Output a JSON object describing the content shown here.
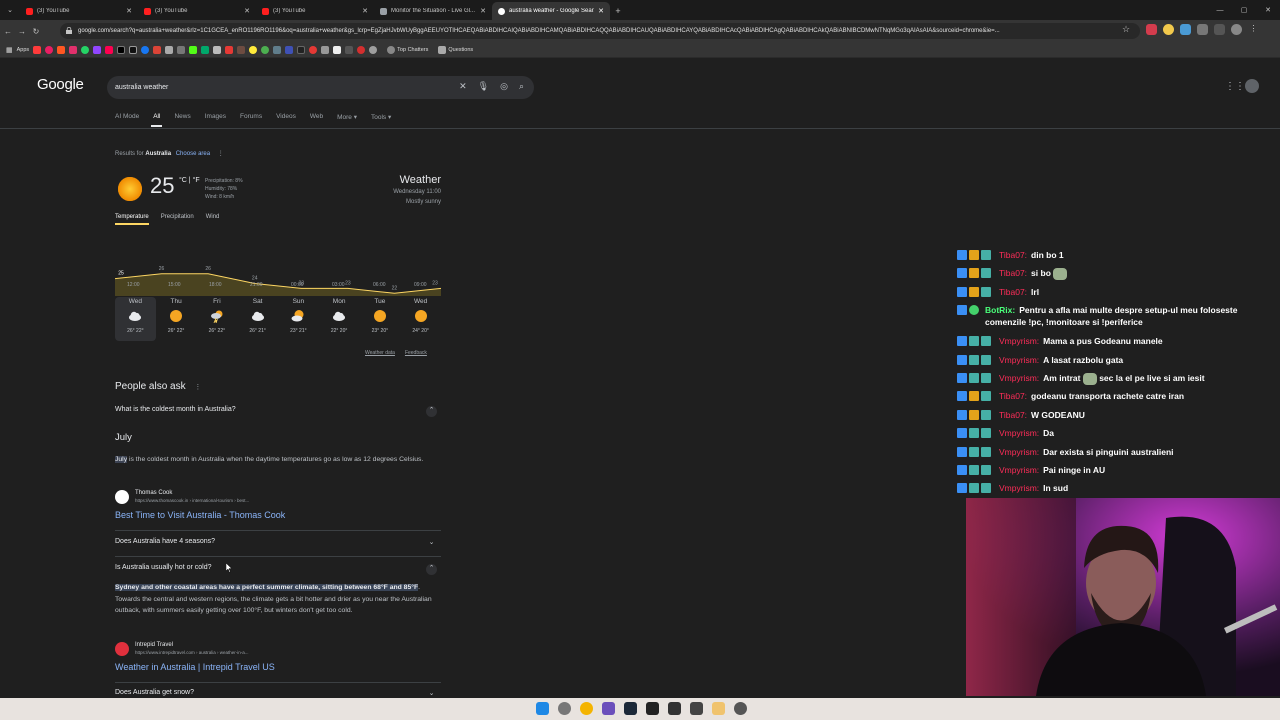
{
  "tabs": [
    {
      "label": "(3) YouTube",
      "favicon": "youtube-icon",
      "active": false
    },
    {
      "label": "(3) YouTube",
      "favicon": "youtube-icon",
      "active": false
    },
    {
      "label": "(3) YouTube",
      "favicon": "youtube-icon",
      "active": false
    },
    {
      "label": "Monitor the Situation - Live Gl...",
      "favicon": "monitor-icon",
      "active": false
    },
    {
      "label": "australia weather - Google Sear...",
      "favicon": "google-icon",
      "active": true
    }
  ],
  "address_bar": {
    "url": "google.com/search?q=australia+weather&rlz=1C1GCEA_enRO1196RO1196&oq=australia+weather&gs_lcrp=EgZjaHJvbWUyBggAEEUYOTIHCAEQABiABDIHCAIQABiABDIHCAMQABiABDIHCAQQABiABDIHCAUQABiABDIHCAYQABiABDIHCAcQABiABDIHCAgQABiABDIHCAkQABiABNIBCDMwNTNqMGo3qAIAsAIA&sourceid=chrome&ie=..."
  },
  "bookmarks": {
    "apps_label": "Apps",
    "top_chatters": "Top Chatters",
    "questions": "Questions"
  },
  "google": {
    "logo": "Google",
    "query": "australia weather",
    "filters": [
      "AI Mode",
      "All",
      "News",
      "Images",
      "Forums",
      "Videos",
      "Web",
      "More ▾",
      "Tools ▾"
    ],
    "results_for_prefix": "Results for",
    "results_for_place": "Australia",
    "choose_area": "Choose area"
  },
  "weather": {
    "temperature": "25",
    "units": "°C | °F",
    "precipitation": "Precipitation: 8%",
    "humidity": "Humidity: 78%",
    "wind": "Wind: 8 km/h",
    "heading": "Weather",
    "day_time": "Wednesday 11:00",
    "condition": "Mostly sunny",
    "tabs": [
      "Temperature",
      "Precipitation",
      "Wind"
    ],
    "chart_points": [
      25,
      26,
      26,
      24,
      23,
      23,
      22,
      23
    ],
    "hours": [
      "12:00",
      "15:00",
      "18:00",
      "21:00",
      "00:00",
      "03:00",
      "06:00",
      "09:00"
    ],
    "days": [
      {
        "name": "Wed",
        "temps": "26° 22°",
        "icon": "cloudy-icon"
      },
      {
        "name": "Thu",
        "temps": "26° 22°",
        "icon": "sunny-icon"
      },
      {
        "name": "Fri",
        "temps": "26° 22°",
        "icon": "thunderstorm-icon"
      },
      {
        "name": "Sat",
        "temps": "26° 21°",
        "icon": "cloudy-icon"
      },
      {
        "name": "Sun",
        "temps": "23° 21°",
        "icon": "partly-sunny-icon"
      },
      {
        "name": "Mon",
        "temps": "22° 20°",
        "icon": "cloudy-icon"
      },
      {
        "name": "Tue",
        "temps": "23° 20°",
        "icon": "sunny-icon"
      },
      {
        "name": "Wed",
        "temps": "24° 20°",
        "icon": "sunny-icon"
      }
    ],
    "weather_data_link": "Weather data",
    "feedback_link": "Feedback"
  },
  "people_also_ask": {
    "heading": "People also ask",
    "q1": "What is the coldest month in Australia?",
    "a1_heading": "July",
    "a1_highlight": "July",
    "a1_text": " is the coldest month in Australia when the daytime temperatures go as low as 12 degrees Celsius.",
    "src1_name": "Thomas Cook",
    "src1_url": "https://www.thomascook.in › international-tourism › best...",
    "src1_title": "Best Time to Visit Australia - Thomas Cook",
    "q2": "Does Australia have 4 seasons?",
    "q3": "Is Australia usually hot or cold?",
    "a3_highlight": "Sydney and other coastal areas have a perfect summer climate, sitting between 68°F and 85°F",
    "a3_text": ". Towards the central and western regions, the climate gets a bit hotter and drier as you near the Australian outback, with summers easily getting over 100°F, but winters don't get too cold.",
    "src3_name": "Intrepid Travel",
    "src3_url": "https://www.intrepidtravel.com › australia › weather-in-a...",
    "src3_title": "Weather in Australia | Intrepid Travel US",
    "q4": "Does Australia get snow?"
  },
  "chat": [
    {
      "user": "Tiba07:",
      "text": "din bo 1"
    },
    {
      "user": "Tiba07:",
      "text": "si bo",
      "emote": true
    },
    {
      "user": "Tiba07:",
      "text": "lrl"
    },
    {
      "user": "BotRix:",
      "text": "Pentru a afla mai multe despre setup-ul meu foloseste comenzile !pc, !monitoare si !periferice",
      "bot": true
    },
    {
      "user": "Vmpyrism:",
      "text": "Mama a pus Godeanu manele"
    },
    {
      "user": "Vmpyrism:",
      "text": "A lasat razbolu gata"
    },
    {
      "user": "Vmpyrism:",
      "text": "Am intrat",
      "emote": true,
      "text2": "sec la el pe live si am iesit"
    },
    {
      "user": "Tiba07:",
      "text": "godeanu transporta rachete catre iran"
    },
    {
      "user": "Tiba07:",
      "text": "W GODEANU"
    },
    {
      "user": "Vmpyrism:",
      "text": "Da"
    },
    {
      "user": "Vmpyrism:",
      "text": "Dar exista si pinguini australieni"
    },
    {
      "user": "Vmpyrism:",
      "text": "Pai ninge in AU"
    },
    {
      "user": "Vmpyrism:",
      "text": "In sud"
    }
  ]
}
